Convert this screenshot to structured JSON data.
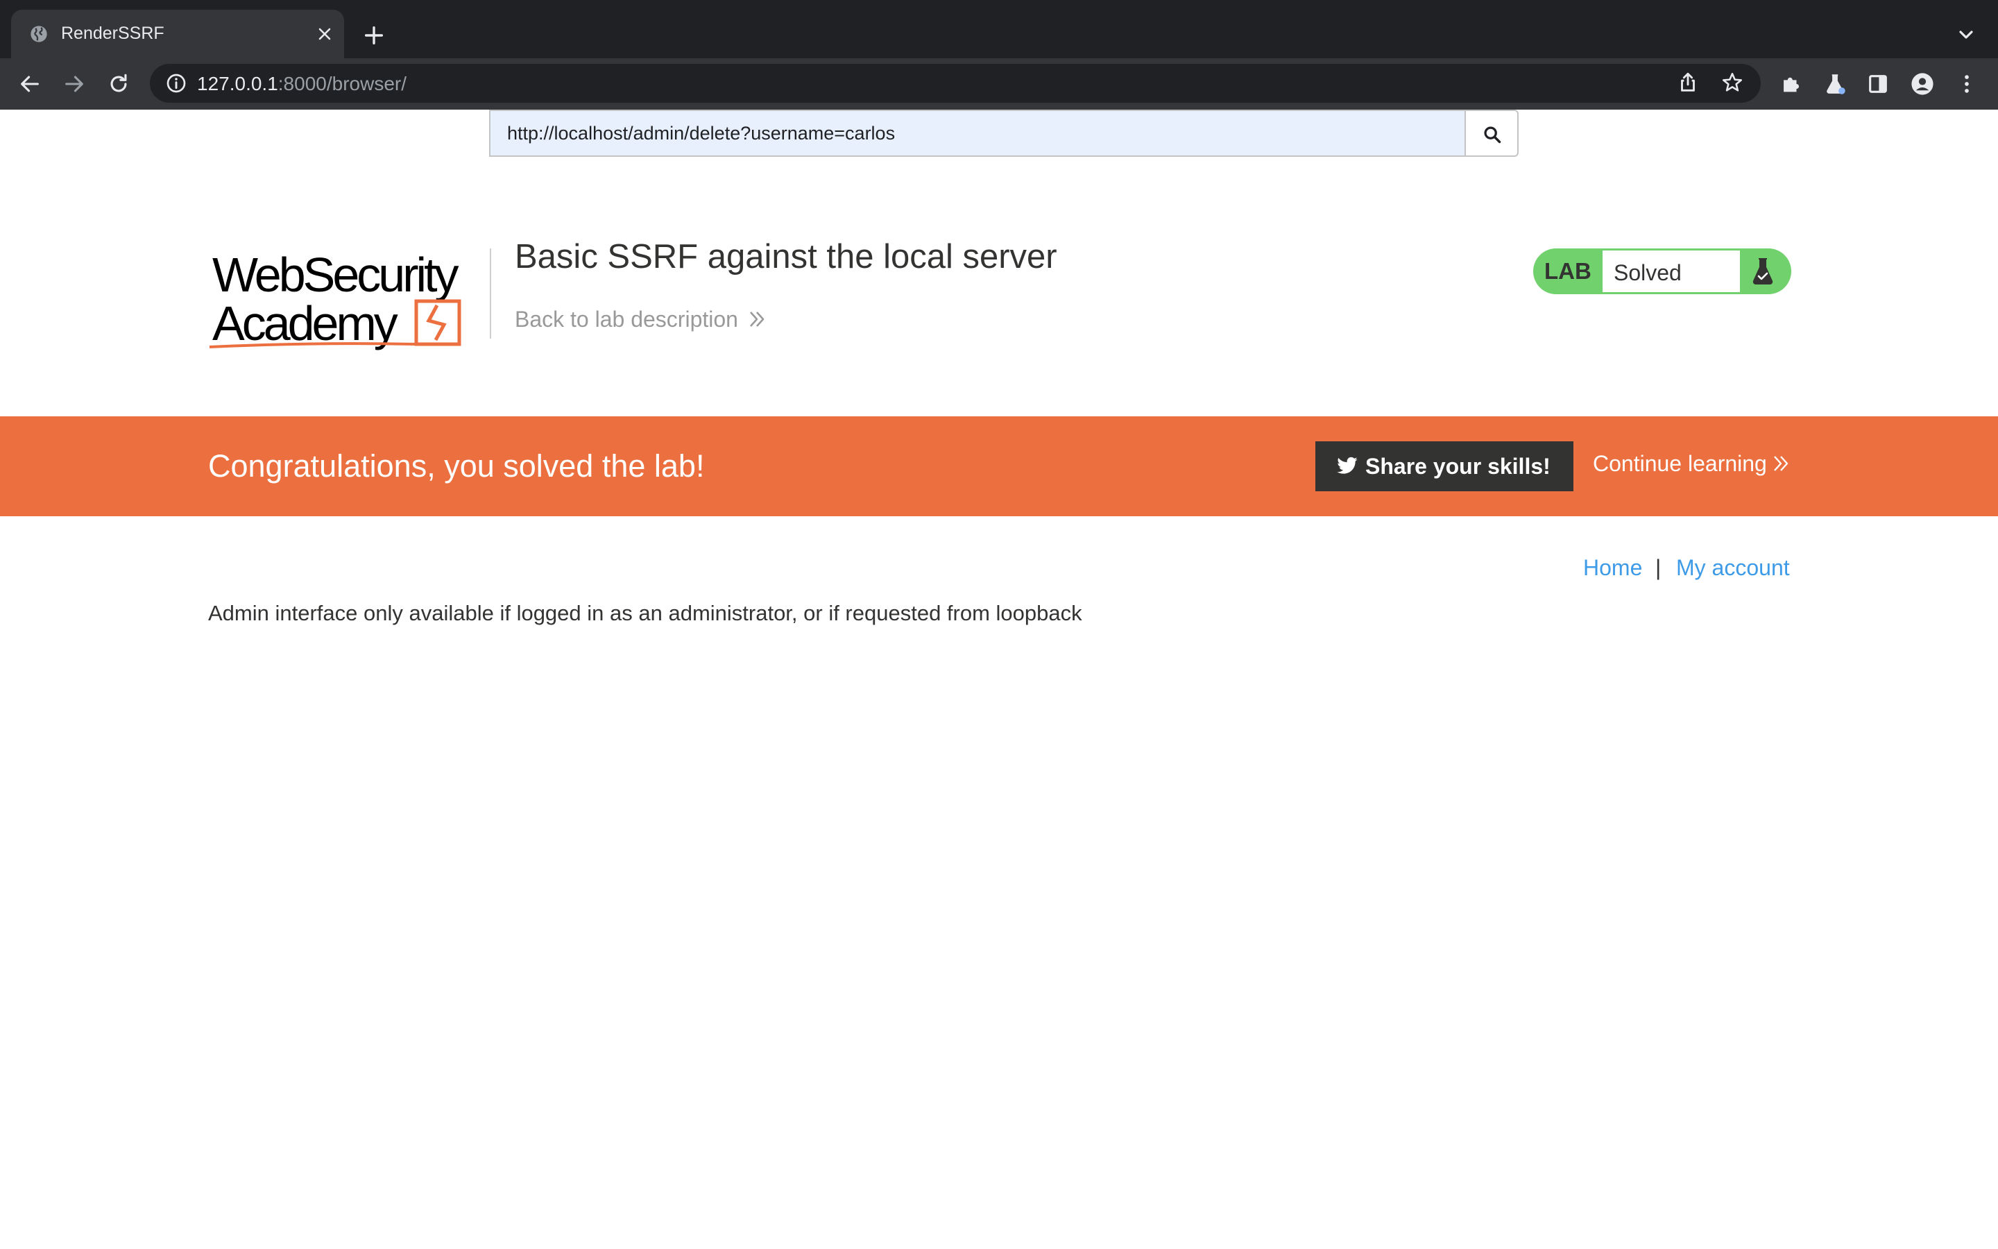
{
  "browser": {
    "tab_title": "RenderSSRF",
    "url_host": "127.0.0.1",
    "url_rest": ":8000/browser/"
  },
  "fetch_form": {
    "url_value": "http://localhost/admin/delete?username=carlos"
  },
  "header": {
    "logo_line1": "WebSecurity",
    "logo_line2": "Academy",
    "lab_title": "Basic SSRF against the local server",
    "back_link": "Back to lab description"
  },
  "lab_status": {
    "label": "LAB",
    "state": "Solved",
    "accent_color": "#70d16d"
  },
  "banner": {
    "message": "Congratulations, you solved the lab!",
    "share_label": "Share your skills!",
    "continue_label": "Continue learning",
    "color": "#ec6f3f"
  },
  "nav": {
    "home": "Home",
    "separator": "|",
    "account": "My account"
  },
  "main": {
    "message": "Admin interface only available if logged in as an administrator, or if requested from loopback"
  },
  "icons": {
    "favicon": "globe-icon",
    "tab_close": "close-icon",
    "new_tab": "plus-icon",
    "back": "back-arrow-icon",
    "forward": "forward-arrow-icon",
    "reload": "reload-icon",
    "site_info": "info-icon",
    "share": "share-icon",
    "bookmark": "star-icon",
    "extensions": "puzzle-icon",
    "lab_extension": "flask-icon",
    "side_panel": "side-panel-icon",
    "profile": "profile-icon",
    "menu": "kebab-menu-icon",
    "fetch": "search-icon",
    "twitter": "twitter-icon"
  }
}
